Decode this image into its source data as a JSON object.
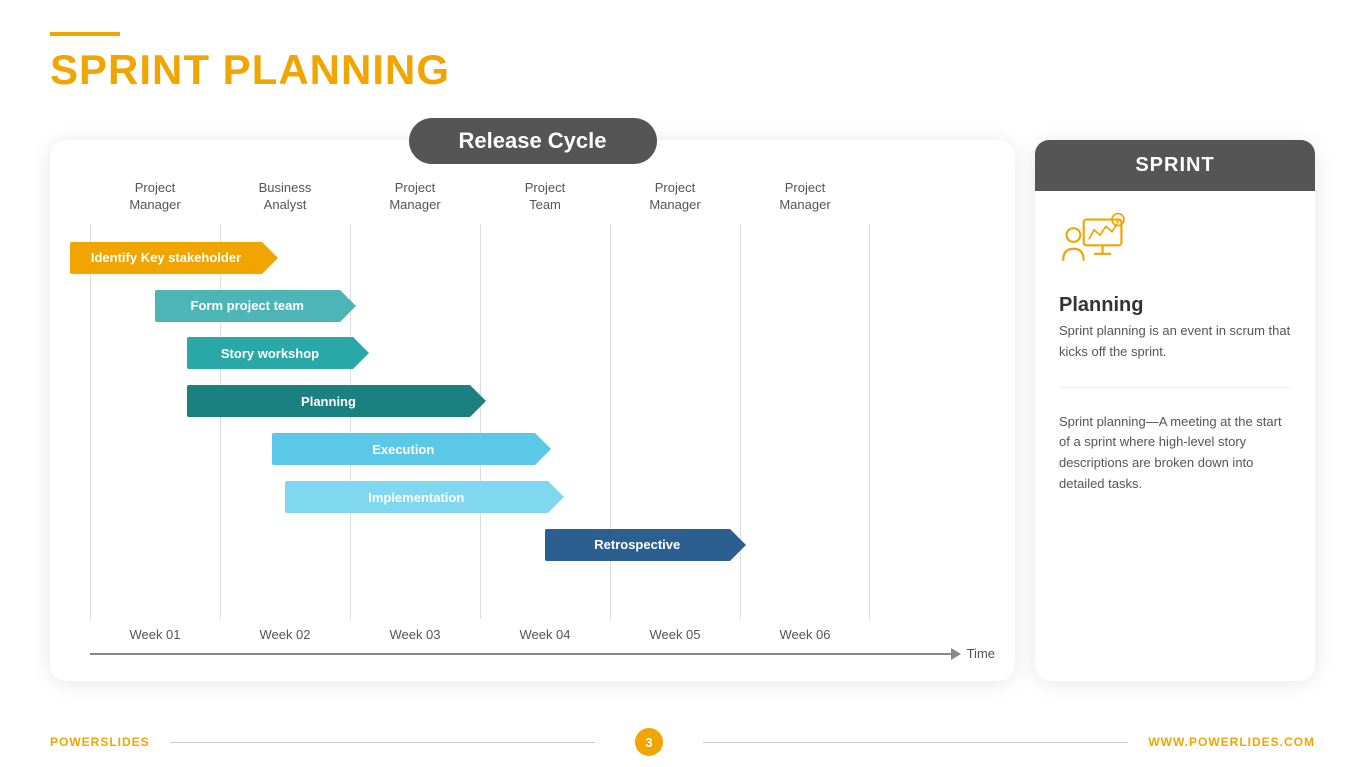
{
  "header": {
    "line_color": "#f0a500",
    "title_part1": "SPRINT",
    "title_part2": " PLANNING"
  },
  "release_badge": "Release Cycle",
  "col_headers": [
    {
      "line1": "Project",
      "line2": "Manager"
    },
    {
      "line1": "Business",
      "line2": "Analyst"
    },
    {
      "line1": "Project",
      "line2": "Manager"
    },
    {
      "line1": "Project",
      "line2": "Team"
    },
    {
      "line1": "Project",
      "line2": "Manager"
    },
    {
      "line1": "Project",
      "line2": "Manager"
    }
  ],
  "bars": [
    {
      "label": "Identify Key stakeholder",
      "color": "orange",
      "start": 0,
      "span": 1.6
    },
    {
      "label": "Form project team",
      "color": "teal-light",
      "start": 0.7,
      "span": 1.5
    },
    {
      "label": "Story workshop",
      "color": "teal-mid",
      "start": 0.9,
      "span": 1.4
    },
    {
      "label": "Planning",
      "color": "teal-dark",
      "start": 0.9,
      "span": 2.2
    },
    {
      "label": "Execution",
      "color": "blue-light",
      "start": 1.6,
      "span": 2.0
    },
    {
      "label": "Implementation",
      "color": "blue-lighter",
      "start": 1.7,
      "span": 2.1
    },
    {
      "label": "Retrospective",
      "color": "navy",
      "start": 3.7,
      "span": 1.5
    }
  ],
  "week_labels": [
    "Week 01",
    "Week 02",
    "Week 03",
    "Week 04",
    "Week 05",
    "Week 06"
  ],
  "time_label": "Time",
  "sprint_card": {
    "badge": "SPRINT",
    "planning_title": "Planning",
    "planning_text1": "Sprint planning is an event in scrum that kicks off the sprint.",
    "planning_text2": "Sprint planning—A meeting at the start of a sprint where high-level story descriptions are broken down into detailed tasks."
  },
  "footer": {
    "brand_part1": "POWER",
    "brand_part2": "SLIDES",
    "page": "3",
    "website": "WWW.POWERLIDES.COM"
  }
}
